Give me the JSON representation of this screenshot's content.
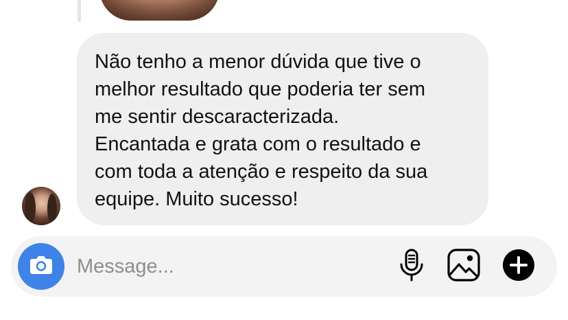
{
  "message": {
    "text": "Não tenho a menor dúvida que tive o\nmelhor resultado que poderia ter sem\nme sentir descaracterizada.\nEncantada e grata com o resultado e\ncom toda a atenção e respeito da sua\nequipe. Muito sucesso!"
  },
  "composer": {
    "placeholder": "Message..."
  },
  "icons": {
    "camera": "camera-icon",
    "microphone": "microphone-icon",
    "gallery": "image-gallery-icon",
    "add": "plus-icon"
  },
  "colors": {
    "bubble_background": "#efefef",
    "composer_background": "#f3f3f3",
    "camera_button": "#3f82e8",
    "text": "#111111",
    "placeholder": "#8e8e8e"
  }
}
